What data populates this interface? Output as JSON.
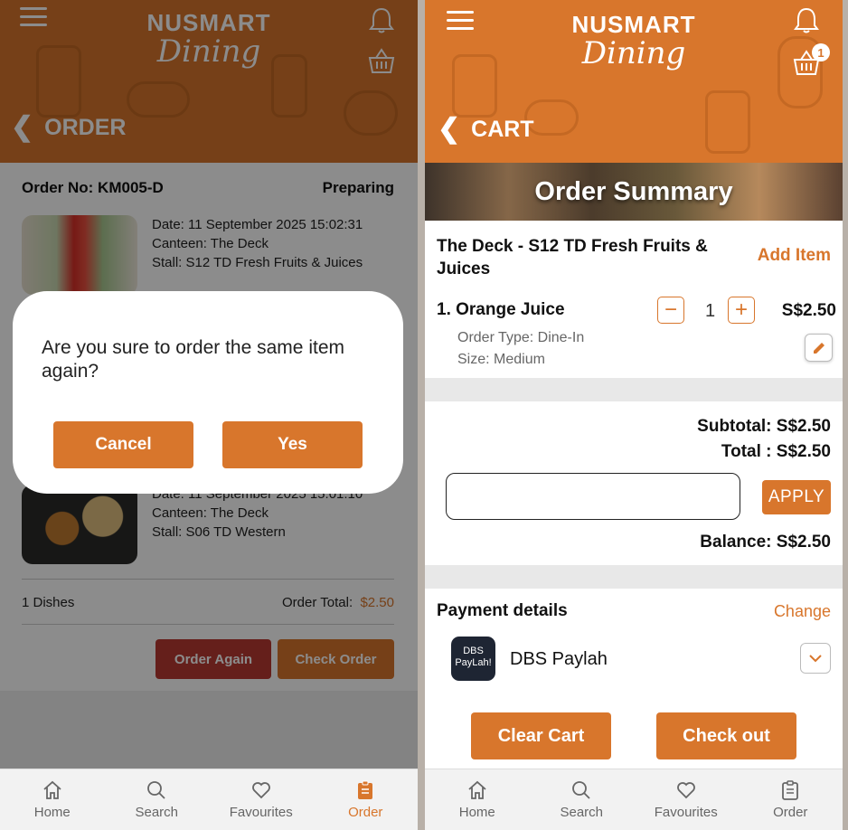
{
  "brand": {
    "name": "NUSMART",
    "sub": "Dining"
  },
  "left": {
    "title": "ORDER",
    "order_no": "Order No: KM005-D",
    "status": "Preparing",
    "items": [
      {
        "date": "Date: 11 September 2025 15:02:31",
        "canteen": "Canteen: The Deck",
        "stall": "Stall: S12 TD Fresh Fruits & Juices"
      },
      {
        "date": "Date: 11 September 2025 15:01:10",
        "canteen": "Canteen: The Deck",
        "stall": "Stall: S06 TD Western"
      }
    ],
    "dishes": "1 Dishes",
    "order_total_label": "Order Total:",
    "order_total_value": "$2.50",
    "order_again_label": "Order Again",
    "check_order_label": "Check Order",
    "dialog": {
      "message": "Are you sure to order the same item again?",
      "cancel_label": "Cancel",
      "yes_label": "Yes"
    }
  },
  "right": {
    "title": "CART",
    "cart_badge": "1",
    "banner_title": "Order Summary",
    "stall_name": "The Deck - S12 TD Fresh Fruits & Juices",
    "add_item_label": "Add Item",
    "item_name": "1. Orange Juice",
    "quantity": "1",
    "item_price": "S$2.50",
    "order_type": "Order Type: Dine-In",
    "size": "Size: Medium",
    "subtotal": "Subtotal: S$2.50",
    "total": "Total : S$2.50",
    "promo_placeholder": "",
    "apply_label": "APPLY",
    "balance": "Balance: S$2.50",
    "payment_title": "Payment details",
    "change_label": "Change",
    "payment_method": "DBS Paylah",
    "payment_logo_text": "DBS PayLah!",
    "clear_cart_label": "Clear Cart",
    "checkout_label": "Check out"
  },
  "tabs": [
    {
      "label": "Home",
      "icon": "home-icon"
    },
    {
      "label": "Search",
      "icon": "search-icon"
    },
    {
      "label": "Favourites",
      "icon": "heart-icon"
    },
    {
      "label": "Order",
      "icon": "clipboard-icon"
    }
  ],
  "colors": {
    "accent": "#d8762c",
    "order_again": "#b93a32",
    "overlay": "rgba(0,0,0,0.45)"
  }
}
